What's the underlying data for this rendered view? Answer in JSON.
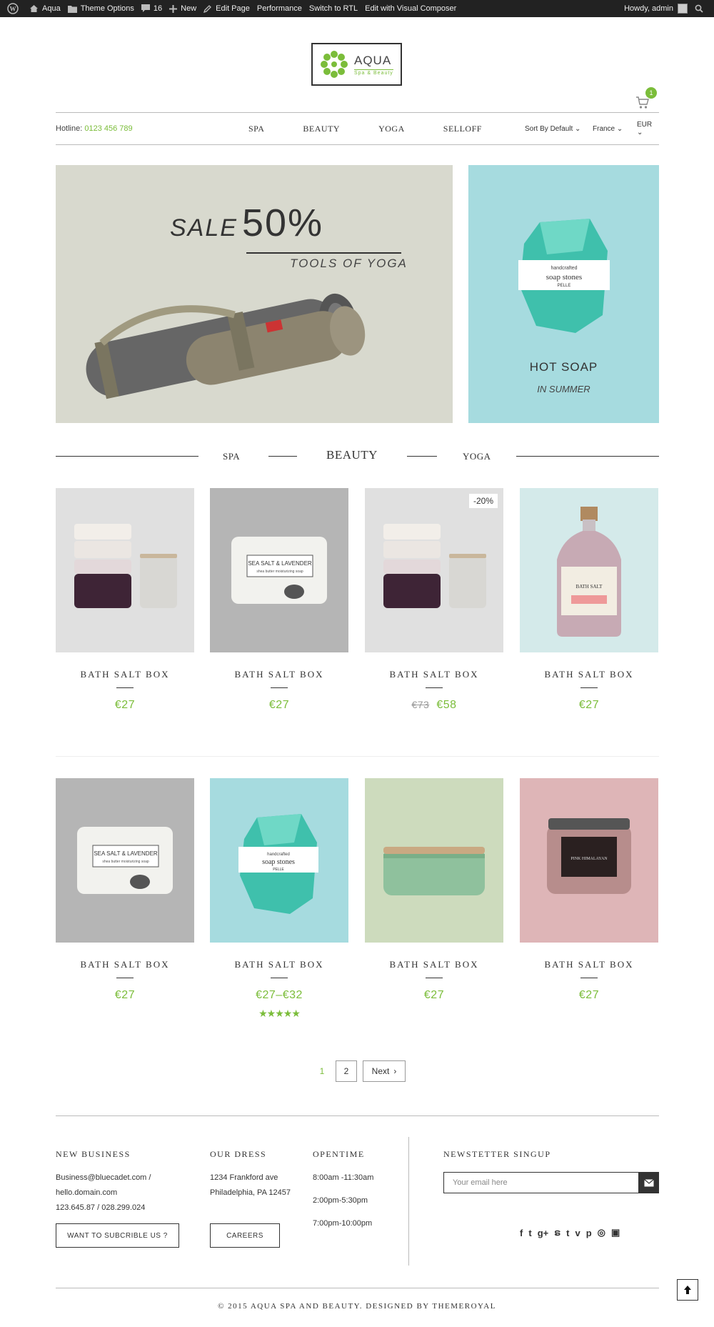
{
  "adminbar": {
    "site": "Aqua",
    "theme_options": "Theme Options",
    "comments": "16",
    "new": "New",
    "edit_page": "Edit Page",
    "performance": "Performance",
    "rtl": "Switch to RTL",
    "visual_composer": "Edit with Visual Composer",
    "howdy": "Howdy, admin"
  },
  "logo": {
    "title": "AQUA",
    "subtitle": "Spa & Beauty"
  },
  "cart": {
    "count": "1"
  },
  "header": {
    "hotline_label": "Hotline:",
    "hotline_number": "0123 456 789",
    "menu": [
      "SPA",
      "BEAUTY",
      "YOGA",
      "SELLOFF"
    ],
    "sort": "Sort By Default",
    "country": "France",
    "currency": "EUR"
  },
  "banner_main": {
    "sale": "SALE",
    "percent": "50%",
    "subtitle": "TOOLS OF YOGA"
  },
  "banner_side": {
    "title": "HOT SOAP",
    "subtitle": "IN SUMMER"
  },
  "tabs": [
    "SPA",
    "BEAUTY",
    "YOGA"
  ],
  "products": [
    {
      "name": "BATH SALT BOX",
      "price": "€27",
      "old_price": "",
      "discount": "",
      "bg": "#e0e0e0"
    },
    {
      "name": "BATH SALT BOX",
      "price": "€27",
      "old_price": "",
      "discount": "",
      "bg": "#b5b5b5"
    },
    {
      "name": "BATH SALT BOX",
      "price": "€58",
      "old_price": "€73",
      "discount": "-20%",
      "bg": "#e0e0e0"
    },
    {
      "name": "BATH SALT BOX",
      "price": "€27",
      "old_price": "",
      "discount": "",
      "bg": "#d4eaea"
    },
    {
      "name": "BATH SALT BOX",
      "price": "€27",
      "old_price": "",
      "discount": "",
      "bg": "#b5b5b5"
    },
    {
      "name": "BATH SALT BOX",
      "price": "€27–€32",
      "old_price": "",
      "discount": "",
      "bg": "#a6dbdf",
      "rating": 5
    },
    {
      "name": "BATH SALT BOX",
      "price": "€27",
      "old_price": "",
      "discount": "",
      "bg": "#cddbbd"
    },
    {
      "name": "BATH SALT BOX",
      "price": "€27",
      "old_price": "",
      "discount": "",
      "bg": "#deb5b7"
    }
  ],
  "product_labels": {
    "soap_band": "SEA SALT & LAVENDER",
    "soap_sub": "shea butter moisturizing soap",
    "soap_stone_top": "handcrafted",
    "soap_stone": "soap stones",
    "soap_stone_brand": "PELLE",
    "salt_label": "BATH SALT",
    "jar_label": "PINK HIMALAYAN"
  },
  "pagination": {
    "current": "1",
    "page2": "2",
    "next": "Next"
  },
  "footer": {
    "business": {
      "title": "NEW BUSINESS",
      "line1": "Business@bluecadet.com /",
      "line2": "hello.domain.com",
      "line3": "123.645.87 / 028.299.024",
      "button": "WANT TO SUBCRIBLE US ?"
    },
    "address": {
      "title": "OUR DRESS",
      "line1": "1234 Frankford ave",
      "line2": "Philadelphia, PA 12457",
      "button": "CAREERS"
    },
    "opentime": {
      "title": "OPENTIME",
      "line1": "8:00am -11:30am",
      "line2": "2:00pm-5:30pm",
      "line3": "7:00pm-10:00pm"
    },
    "newsletter": {
      "title": "NEWSTETTER SINGUP",
      "placeholder": "Your email here"
    },
    "social_icons": [
      "facebook-icon",
      "twitter-icon",
      "google-plus-icon",
      "stumbleupon-icon",
      "tumblr-icon",
      "vine-icon",
      "pinterest-icon",
      "dribbble-icon",
      "instagram-icon"
    ],
    "copyright": "© 2015 AQUA SPA AND BEAUTY. DESIGNED BY THEMEROYAL"
  },
  "colors": {
    "accent": "#7bbd3a",
    "dark": "#333333"
  }
}
